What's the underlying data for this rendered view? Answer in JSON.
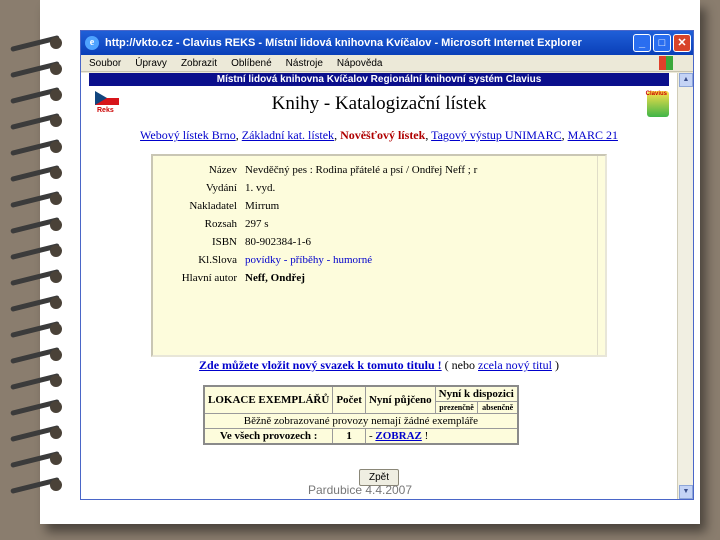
{
  "window": {
    "title": "http://vkto.cz - Clavius REKS - Místní lidová knihovna Kvíčalov - Microsoft Internet Explorer",
    "buttons": {
      "minimize": "_",
      "maximize": "□",
      "close": "✕"
    }
  },
  "menu": [
    "Soubor",
    "Úpravy",
    "Zobrazit",
    "Oblíbené",
    "Nástroje",
    "Nápověda"
  ],
  "page": {
    "banner": "Místní lidová knihovna Kvíčalov   Regionální knihovní systém Clavius",
    "title": "Knihy - Katalogizační lístek",
    "lang_label": "Reks",
    "logo_label": "Clavius",
    "links": [
      {
        "label": "Webový lístek Brno",
        "active": false
      },
      {
        "label": "Základní kat. lístek",
        "active": false
      },
      {
        "label": "Nověšťový lístek",
        "active": true
      },
      {
        "label": "Tagový výstup UNIMARC",
        "active": false
      },
      {
        "label": "MARC 21",
        "active": false
      }
    ],
    "link_separator": ","
  },
  "record": {
    "rows": [
      {
        "label": "Název",
        "value": "Nevděčný pes : Rodina přátelé a psí / Ondřej Neff ; r",
        "style": ""
      },
      {
        "label": "Vydání",
        "value": "1. vyd.",
        "style": ""
      },
      {
        "label": "Nakladatel",
        "value": "Mirrum",
        "style": ""
      },
      {
        "label": "Rozsah",
        "value": "297 s",
        "style": ""
      },
      {
        "label": "ISBN",
        "value": "80-902384-1-6",
        "style": ""
      },
      {
        "label": "Kl.Slova",
        "value": "povídky - příběhy - humorné",
        "style": "link"
      },
      {
        "label": "Hlavní autor",
        "value": "Neff, Ondřej",
        "style": "bold"
      }
    ]
  },
  "add_volume": {
    "link": "Zde můžete vložit nový svazek k tomuto titulu !",
    "middle": "( nebo",
    "link2": "zcela nový titul",
    "end": ")"
  },
  "locations": {
    "headers": {
      "lokace": "LOKACE EXEMPLÁŘŮ",
      "pocet": "Počet",
      "nyni_pujceno": "Nyní půjčeno",
      "nyni_k_dispozici": "Nyní k dispozici",
      "prezencne": "prezenčně",
      "absencne": "absenčně"
    },
    "note": "Běžně zobrazované provozy nemají žádné exempláře",
    "total_label": "Ve všech provozech :",
    "total_count": "1",
    "show_prefix": "-",
    "show_link": "ZOBRAZ",
    "show_suffix": "!"
  },
  "back_button": "Zpět",
  "footer": "Pardubice 4.4.2007"
}
